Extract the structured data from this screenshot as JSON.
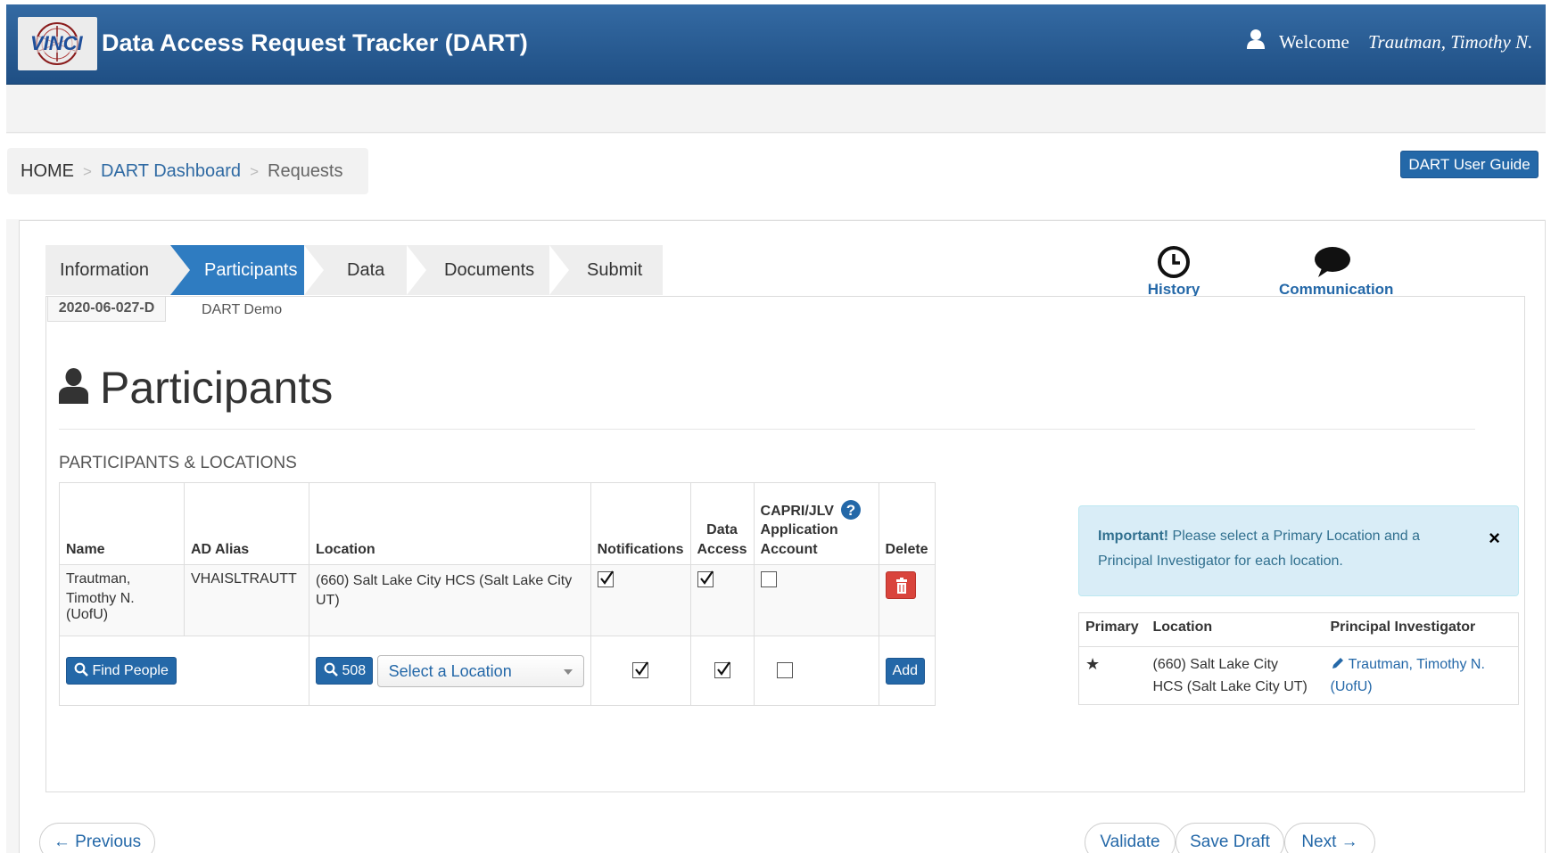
{
  "header": {
    "title": "Data Access Request Tracker (DART)",
    "welcome": "Welcome",
    "user_name": "Trautman,  Timothy  N.",
    "logo_text": "VINCI"
  },
  "breadcrumb": {
    "home": "HOME",
    "dashboard": "DART Dashboard",
    "current": "Requests"
  },
  "user_guide_label": "DART User Guide",
  "steps": [
    {
      "label": "Information",
      "active": false
    },
    {
      "label": "Participants",
      "active": true
    },
    {
      "label": "Data",
      "active": false
    },
    {
      "label": "Documents",
      "active": false
    },
    {
      "label": "Submit",
      "active": false
    }
  ],
  "tools": {
    "history": "History",
    "communication": "Communication"
  },
  "request": {
    "id": "2020-06-027-D",
    "name": "DART Demo"
  },
  "page_title": "Participants",
  "section_label": "PARTICIPANTS & LOCATIONS",
  "participants_table": {
    "headers": {
      "name": "Name",
      "ad_alias": "AD Alias",
      "location": "Location",
      "notifications": "Notifications",
      "data_access_1": "Data",
      "data_access_2": "Access",
      "capri_1": "CAPRI/JLV",
      "capri_2": "Application",
      "capri_3": "Account",
      "delete": "Delete"
    },
    "rows": [
      {
        "name_line1": "Trautman,",
        "name_line2": "Timothy N. (UofU)",
        "ad_alias": "VHAISLTRAUTT",
        "location": "(660) Salt Lake City HCS (Salt Lake City UT)",
        "notifications": true,
        "data_access": true,
        "capri": false
      }
    ],
    "add_row": {
      "find_people_label": "Find People",
      "station_label": "508",
      "location_placeholder": "Select a Location",
      "notifications": true,
      "data_access": true,
      "capri": false,
      "add_label": "Add"
    }
  },
  "alert": {
    "strong": "Important!",
    "text": " Please select a Primary Location and a Principal Investigator for each location.",
    "close": "×"
  },
  "locations_table": {
    "headers": {
      "primary": "Primary",
      "location": "Location",
      "pi": "Principal Investigator"
    },
    "rows": [
      {
        "primary_mark": "★",
        "location_line1": "(660) Salt Lake City",
        "location_line2": "HCS (Salt Lake City UT)",
        "pi_line1": "Trautman, Timothy N.",
        "pi_line2": "(UofU)"
      }
    ]
  },
  "footer": {
    "previous": "← Previous",
    "validate": "Validate",
    "save_draft": "Save Draft",
    "next": "Next →"
  },
  "colors": {
    "header_blue": "#2a5e98",
    "accent_blue": "#2f7cc1",
    "link_blue": "#2468a8",
    "delete_red": "#d9443c",
    "alert_bg": "#d9edf7"
  }
}
